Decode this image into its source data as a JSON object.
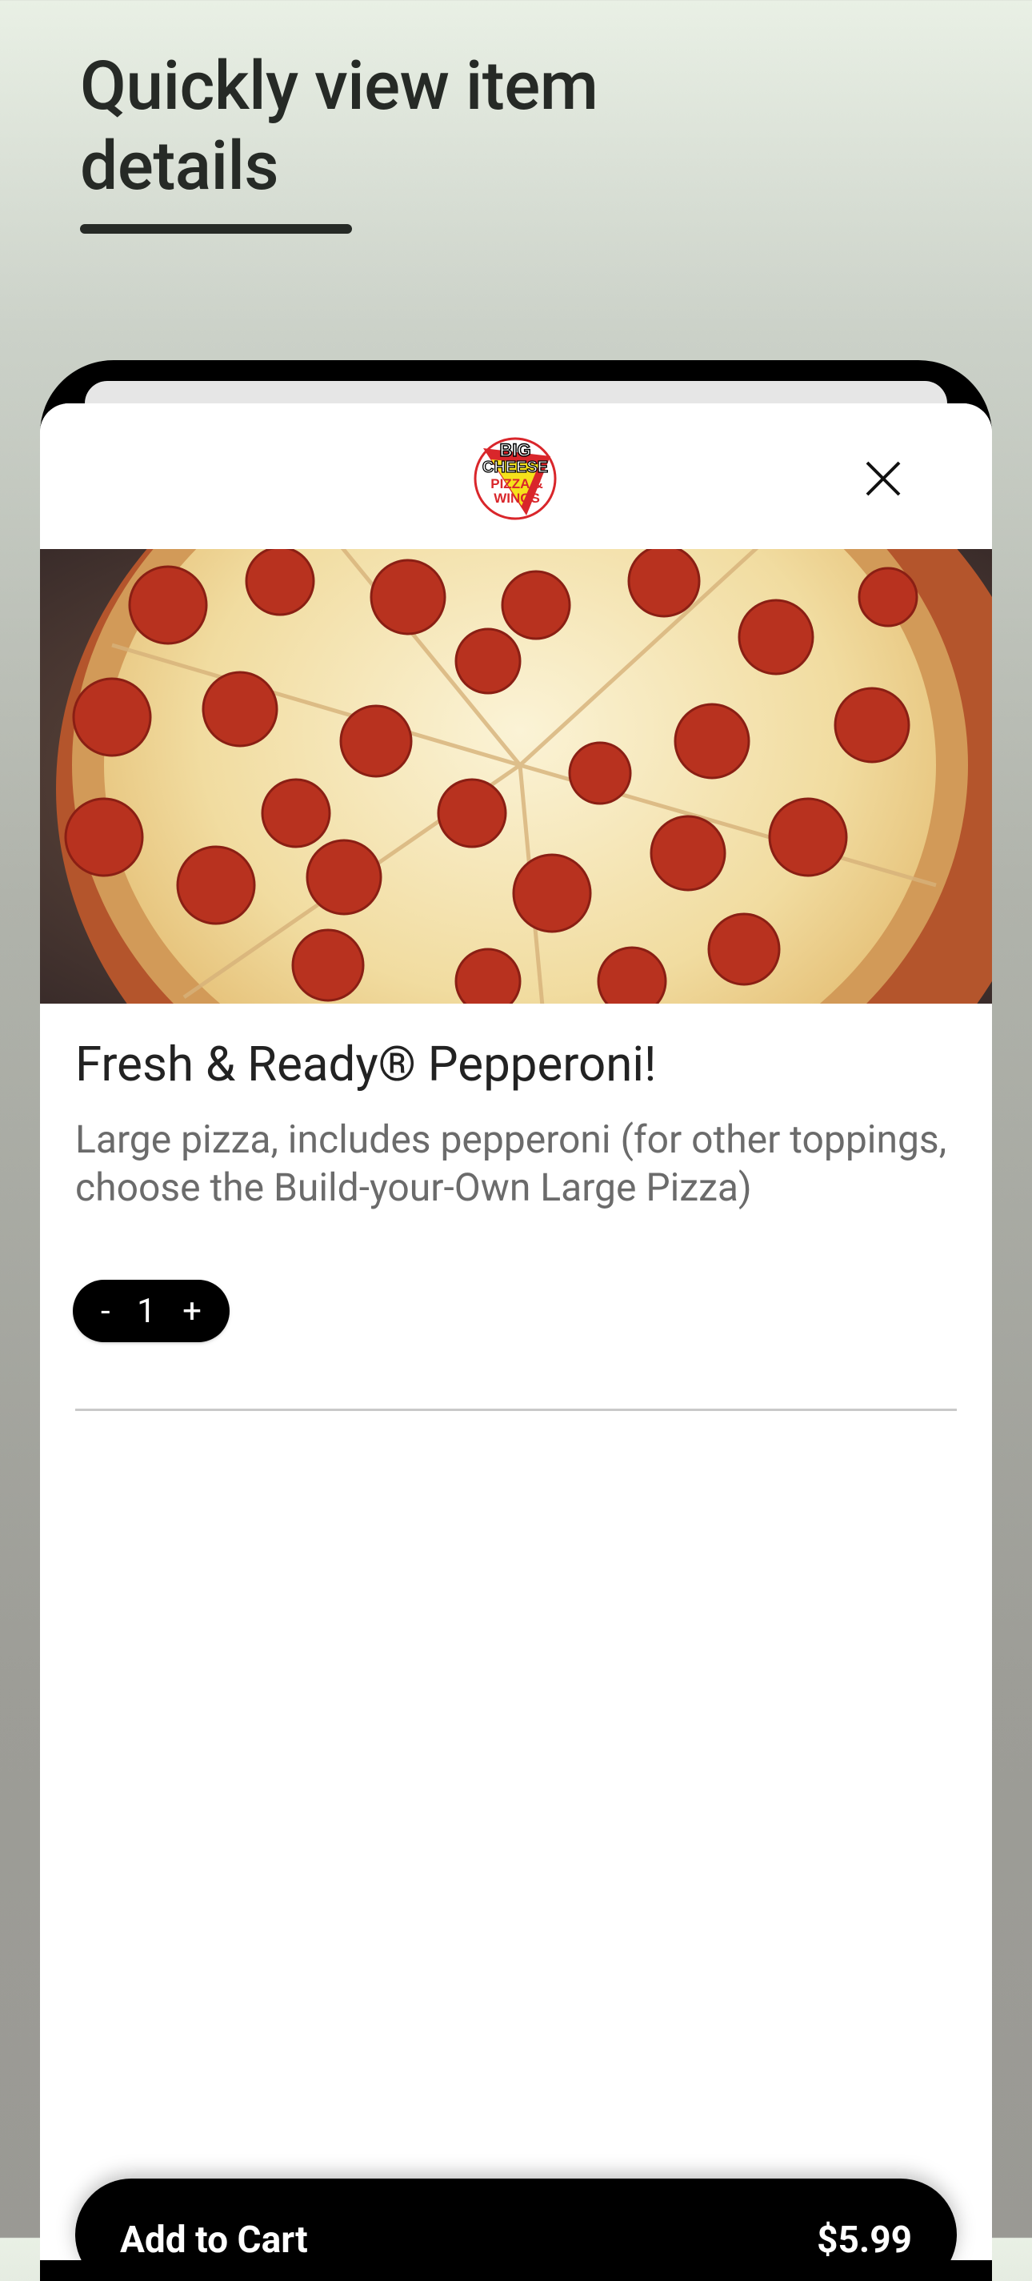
{
  "banner": {
    "headline": "Quickly view item details"
  },
  "brand": {
    "logo_icon": "big-cheese-pizza-wings-logo",
    "logo_lines": [
      "BIG",
      "CHEESE",
      "PIZZA &",
      "WINGS"
    ]
  },
  "item": {
    "image_icon": "pepperoni-pizza-photo",
    "title": "Fresh & Ready® Pepperoni!",
    "description": "Large pizza, includes pepperoni (for other toppings, choose the Build-your-Own Large Pizza)",
    "quantity": {
      "minus_label": "-",
      "value": "1",
      "plus_label": "+"
    }
  },
  "actions": {
    "close_icon": "close-icon",
    "add_to_cart_label": "Add to Cart",
    "price": "$5.99"
  },
  "colors": {
    "accent": "#000000",
    "logo_red": "#d9262b",
    "logo_yellow": "#f5e21b"
  }
}
